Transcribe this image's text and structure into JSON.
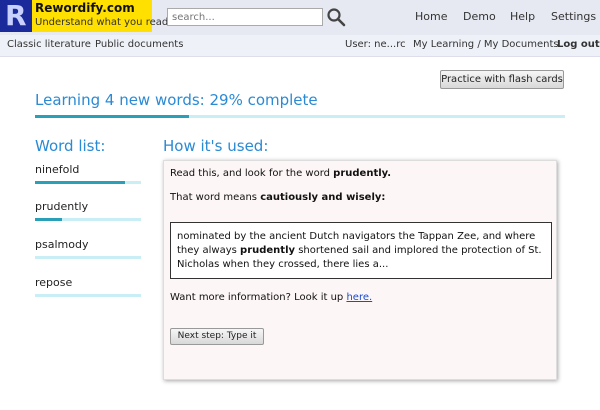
{
  "brand": {
    "name": "Rewordify.com",
    "tagline": "Understand what you read.",
    "logo_letter": "R"
  },
  "search": {
    "placeholder": "search..."
  },
  "topnav": {
    "home": "Home",
    "demo": "Demo",
    "help": "Help",
    "settings": "Settings"
  },
  "subnav": {
    "classic": "Classic literature",
    "public_docs": "Public documents",
    "user": "User: ne...rc",
    "my_learning": "My Learning / My Documents",
    "logout": "Log out"
  },
  "flash_button": "Practice with flash cards",
  "progress": {
    "title": "Learning 4 new words: 29% complete",
    "percent": 29
  },
  "word_list": {
    "heading": "Word list:",
    "items": [
      {
        "word": "ninefold",
        "progress": 0.85
      },
      {
        "word": "prudently",
        "progress": 0.25
      },
      {
        "word": "psalmody",
        "progress": 0.0
      },
      {
        "word": "repose",
        "progress": 0.0
      }
    ]
  },
  "usage": {
    "heading": "How it's used:",
    "intro_prefix": "Read this, and look for the word ",
    "intro_word": "prudently.",
    "meaning_prefix": "That word means ",
    "meaning": "cautiously and wisely:",
    "quote_line1": "nominated by the ancient Dutch navigators the Tappan Zee, and where",
    "quote_line2_prefix": "they always ",
    "quote_word": "prudently",
    "quote_line2_suffix": " shortened sail and implored the protection of St.",
    "quote_line3": "Nicholas when they crossed, there lies a...",
    "more_prefix": "Want more information? Look it up ",
    "more_link": "here.",
    "next_button": "Next step: Type it"
  },
  "colors": {
    "accent": "#2a8ad4",
    "progress": "#2aa0b8",
    "track": "#c9eef6",
    "logo_bg": "#ffe000",
    "logo_r": "#1a2a9a"
  }
}
